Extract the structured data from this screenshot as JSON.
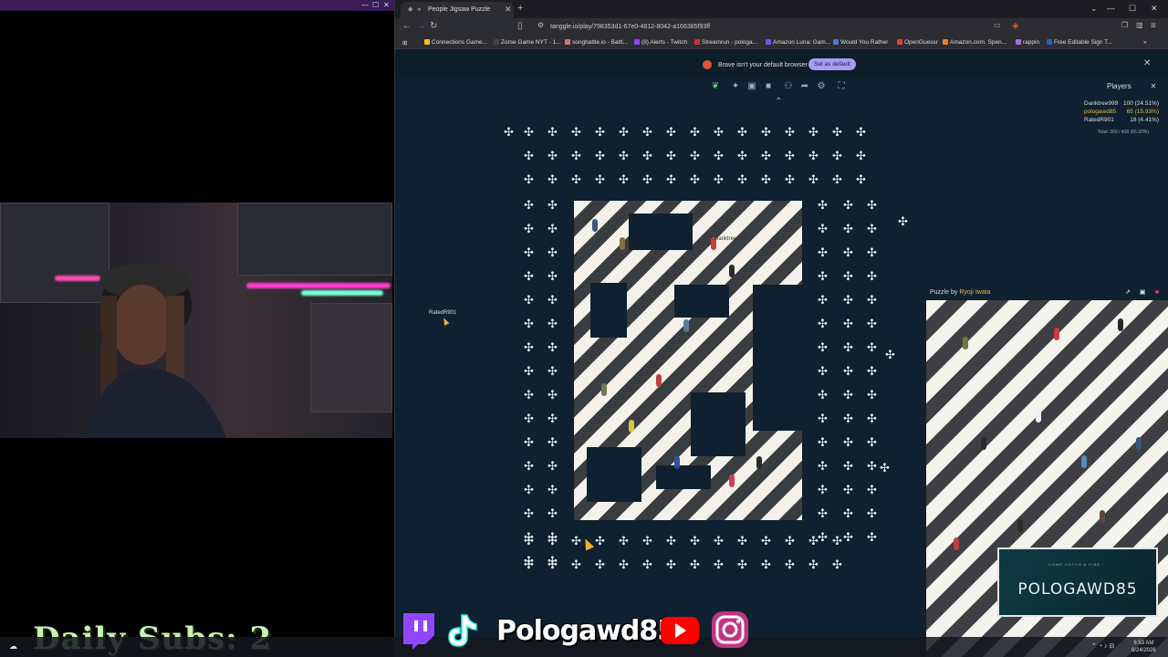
{
  "overlay": {
    "daily_subs": "Daily Subs:  2",
    "handle": "Pologawd85",
    "brb_small": "COME CATCH A VIBE",
    "brb_name": "POLOGAWD85"
  },
  "browser": {
    "tab_title": "People Jigsaw Puzzle",
    "url": "tanggle.io/play/798353d1-67e0-4812-8042-a166385f93ff",
    "bookmarks": [
      "Connections Game...",
      "Zorse Game NYT - 1...",
      "songbattle.io - Battl...",
      "(8) Alerts - Twitch",
      "Streamrun - pologa...",
      "Amazon Luna: Gam...",
      "Would You Rather",
      "OpenGuessr",
      "Amazon.com. Spen...",
      "rappin",
      "Free Editable Sign T..."
    ],
    "notice_text": "Brave isn't your default browser",
    "set_default": "Set as default"
  },
  "puzzle": {
    "players_title": "Players",
    "players": [
      {
        "name": "Danktree999",
        "points": "100 (24.51%)",
        "color": "#dddddd"
      },
      {
        "name": "pologawd85",
        "points": "65 (15.93%)",
        "color": "#e9b93a"
      },
      {
        "name": "RatedR901",
        "points": "18 (4.41%)",
        "color": "#dddddd"
      }
    ],
    "total": "Total: 269 / 408 (65.93%)",
    "cursor_labels": [
      "RatedR901",
      "Danktree999"
    ],
    "ref_by": "Puzzle by",
    "ref_author": "Ryoji Iwata"
  },
  "taskbar": {
    "time": "6:53 AM",
    "date": "8/24/2026"
  },
  "colors": {
    "canvas": "#0f2130",
    "accent": "#a79df2",
    "highlight": "#e9b93a"
  }
}
